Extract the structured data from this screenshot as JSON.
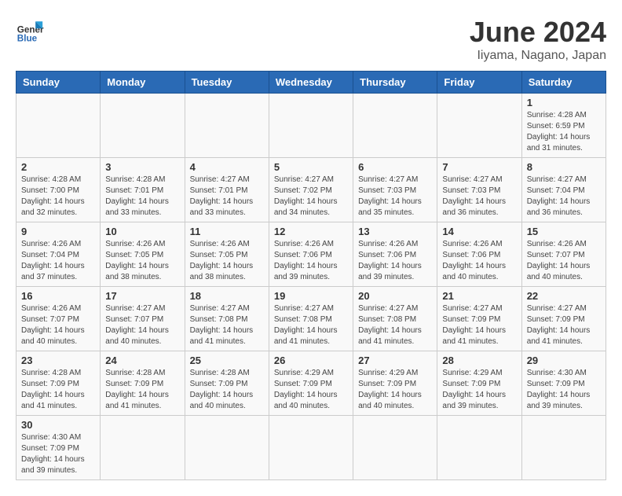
{
  "header": {
    "logo_general": "General",
    "logo_blue": "Blue",
    "title": "June 2024",
    "location": "Iiyama, Nagano, Japan"
  },
  "weekdays": [
    "Sunday",
    "Monday",
    "Tuesday",
    "Wednesday",
    "Thursday",
    "Friday",
    "Saturday"
  ],
  "weeks": [
    [
      {
        "day": "",
        "info": ""
      },
      {
        "day": "",
        "info": ""
      },
      {
        "day": "",
        "info": ""
      },
      {
        "day": "",
        "info": ""
      },
      {
        "day": "",
        "info": ""
      },
      {
        "day": "",
        "info": ""
      },
      {
        "day": "1",
        "info": "Sunrise: 4:28 AM\nSunset: 6:59 PM\nDaylight: 14 hours\nand 31 minutes."
      }
    ],
    [
      {
        "day": "2",
        "info": "Sunrise: 4:28 AM\nSunset: 7:00 PM\nDaylight: 14 hours\nand 32 minutes."
      },
      {
        "day": "3",
        "info": "Sunrise: 4:28 AM\nSunset: 7:01 PM\nDaylight: 14 hours\nand 33 minutes."
      },
      {
        "day": "4",
        "info": "Sunrise: 4:27 AM\nSunset: 7:01 PM\nDaylight: 14 hours\nand 33 minutes."
      },
      {
        "day": "5",
        "info": "Sunrise: 4:27 AM\nSunset: 7:02 PM\nDaylight: 14 hours\nand 34 minutes."
      },
      {
        "day": "6",
        "info": "Sunrise: 4:27 AM\nSunset: 7:03 PM\nDaylight: 14 hours\nand 35 minutes."
      },
      {
        "day": "7",
        "info": "Sunrise: 4:27 AM\nSunset: 7:03 PM\nDaylight: 14 hours\nand 36 minutes."
      },
      {
        "day": "8",
        "info": "Sunrise: 4:27 AM\nSunset: 7:04 PM\nDaylight: 14 hours\nand 36 minutes."
      }
    ],
    [
      {
        "day": "9",
        "info": "Sunrise: 4:26 AM\nSunset: 7:04 PM\nDaylight: 14 hours\nand 37 minutes."
      },
      {
        "day": "10",
        "info": "Sunrise: 4:26 AM\nSunset: 7:05 PM\nDaylight: 14 hours\nand 38 minutes."
      },
      {
        "day": "11",
        "info": "Sunrise: 4:26 AM\nSunset: 7:05 PM\nDaylight: 14 hours\nand 38 minutes."
      },
      {
        "day": "12",
        "info": "Sunrise: 4:26 AM\nSunset: 7:06 PM\nDaylight: 14 hours\nand 39 minutes."
      },
      {
        "day": "13",
        "info": "Sunrise: 4:26 AM\nSunset: 7:06 PM\nDaylight: 14 hours\nand 39 minutes."
      },
      {
        "day": "14",
        "info": "Sunrise: 4:26 AM\nSunset: 7:06 PM\nDaylight: 14 hours\nand 40 minutes."
      },
      {
        "day": "15",
        "info": "Sunrise: 4:26 AM\nSunset: 7:07 PM\nDaylight: 14 hours\nand 40 minutes."
      }
    ],
    [
      {
        "day": "16",
        "info": "Sunrise: 4:26 AM\nSunset: 7:07 PM\nDaylight: 14 hours\nand 40 minutes."
      },
      {
        "day": "17",
        "info": "Sunrise: 4:27 AM\nSunset: 7:07 PM\nDaylight: 14 hours\nand 40 minutes."
      },
      {
        "day": "18",
        "info": "Sunrise: 4:27 AM\nSunset: 7:08 PM\nDaylight: 14 hours\nand 41 minutes."
      },
      {
        "day": "19",
        "info": "Sunrise: 4:27 AM\nSunset: 7:08 PM\nDaylight: 14 hours\nand 41 minutes."
      },
      {
        "day": "20",
        "info": "Sunrise: 4:27 AM\nSunset: 7:08 PM\nDaylight: 14 hours\nand 41 minutes."
      },
      {
        "day": "21",
        "info": "Sunrise: 4:27 AM\nSunset: 7:09 PM\nDaylight: 14 hours\nand 41 minutes."
      },
      {
        "day": "22",
        "info": "Sunrise: 4:27 AM\nSunset: 7:09 PM\nDaylight: 14 hours\nand 41 minutes."
      }
    ],
    [
      {
        "day": "23",
        "info": "Sunrise: 4:28 AM\nSunset: 7:09 PM\nDaylight: 14 hours\nand 41 minutes."
      },
      {
        "day": "24",
        "info": "Sunrise: 4:28 AM\nSunset: 7:09 PM\nDaylight: 14 hours\nand 41 minutes."
      },
      {
        "day": "25",
        "info": "Sunrise: 4:28 AM\nSunset: 7:09 PM\nDaylight: 14 hours\nand 40 minutes."
      },
      {
        "day": "26",
        "info": "Sunrise: 4:29 AM\nSunset: 7:09 PM\nDaylight: 14 hours\nand 40 minutes."
      },
      {
        "day": "27",
        "info": "Sunrise: 4:29 AM\nSunset: 7:09 PM\nDaylight: 14 hours\nand 40 minutes."
      },
      {
        "day": "28",
        "info": "Sunrise: 4:29 AM\nSunset: 7:09 PM\nDaylight: 14 hours\nand 39 minutes."
      },
      {
        "day": "29",
        "info": "Sunrise: 4:30 AM\nSunset: 7:09 PM\nDaylight: 14 hours\nand 39 minutes."
      }
    ],
    [
      {
        "day": "30",
        "info": "Sunrise: 4:30 AM\nSunset: 7:09 PM\nDaylight: 14 hours\nand 39 minutes."
      },
      {
        "day": "",
        "info": ""
      },
      {
        "day": "",
        "info": ""
      },
      {
        "day": "",
        "info": ""
      },
      {
        "day": "",
        "info": ""
      },
      {
        "day": "",
        "info": ""
      },
      {
        "day": "",
        "info": ""
      }
    ]
  ]
}
